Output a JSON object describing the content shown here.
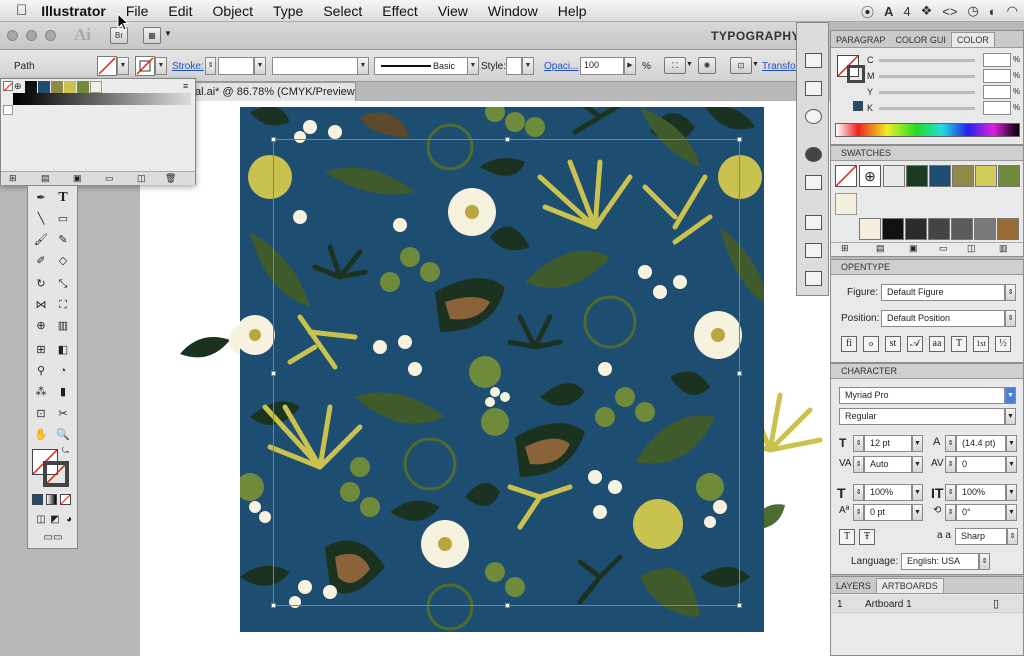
{
  "menubar": {
    "apple": "",
    "app": "Illustrator",
    "items": [
      "File",
      "Edit",
      "Object",
      "Type",
      "Select",
      "Effect",
      "View",
      "Window",
      "Help"
    ],
    "tray_count": "4"
  },
  "appbar": {
    "logo": "Ai",
    "bridge": "Br",
    "workspace": "TYPOGRAPHY"
  },
  "control": {
    "selection": "Path",
    "stroke_label": "Stroke:",
    "brush_value": "Basic",
    "style_label": "Style:",
    "opacity_label": "Opaci...",
    "opacity_value": "100",
    "percent": "%",
    "transform_label": "Transfor"
  },
  "document": {
    "tab_title": "al.ai* @ 86.78% (CMYK/Preview)"
  },
  "color_panel": {
    "tabs": [
      "PARAGRAP",
      "COLOR GUI",
      "COLOR"
    ],
    "channels": [
      {
        "label": "C",
        "value": ""
      },
      {
        "label": "M",
        "value": ""
      },
      {
        "label": "Y",
        "value": ""
      },
      {
        "label": "K",
        "value": ""
      }
    ],
    "unit": "%"
  },
  "swatches_panel": {
    "title": "SWATCHES",
    "row1": [
      "#e8e8e8",
      "#1a3b1f",
      "#1e4d72",
      "#8f8a4a",
      "#d2cb5a",
      "#6e8a3a"
    ],
    "row2": [
      "#f4f0dd",
      "#111",
      "#2b2b2b",
      "#444",
      "#5a5a5a",
      "#7a7a7a",
      "#9a6b35"
    ]
  },
  "opentype": {
    "title": "OPENTYPE",
    "figure_label": "Figure:",
    "figure_value": "Default Figure",
    "position_label": "Position:",
    "position_value": "Default Position",
    "glyph_buttons": [
      "fi",
      "ℴ",
      "st",
      "𝒜",
      "aa",
      "T",
      "1st",
      "½"
    ]
  },
  "character": {
    "title": "CHARACTER",
    "font": "Myriad Pro",
    "style": "Regular",
    "size": "12 pt",
    "leading": "(14.4 pt)",
    "kerning": "Auto",
    "tracking": "0",
    "vscale": "100%",
    "hscale": "100%",
    "baseline": "0 pt",
    "rotation": "0°",
    "aa_label": "a a",
    "aa_value": "Sharp",
    "language_label": "Language:",
    "language_value": "English: USA"
  },
  "layers": {
    "tabs": [
      "LAYERS",
      "ARTBOARDS"
    ],
    "rows": [
      {
        "num": "1",
        "name": "Artboard 1"
      }
    ]
  },
  "colors": {
    "artboard": "#1e4d72",
    "leaf_dark": "#1c3220",
    "leaf_green": "#4e6b30",
    "lime": "#c9c24f",
    "brown": "#8a6438",
    "cream": "#f7f2de"
  }
}
